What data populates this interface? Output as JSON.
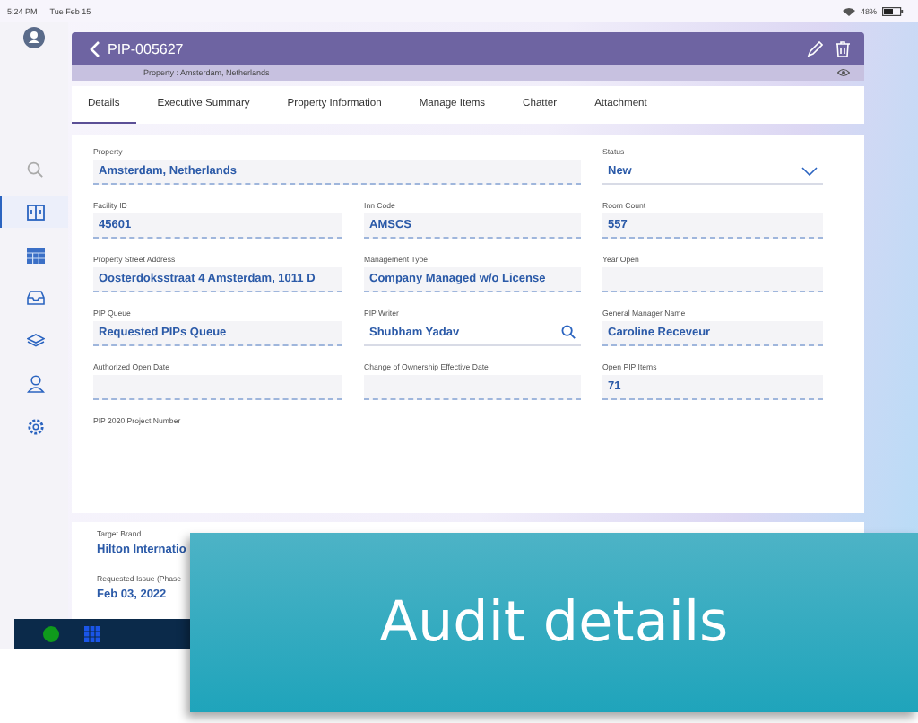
{
  "status_bar": {
    "time": "5:24 PM",
    "date": "Tue Feb 15",
    "battery": "48%"
  },
  "sidebar": {
    "items": [
      {
        "selected": false
      },
      {
        "selected": true
      },
      {
        "selected": false
      },
      {
        "selected": false
      },
      {
        "selected": false
      },
      {
        "selected": false
      },
      {
        "selected": false
      }
    ]
  },
  "header": {
    "title": "PIP-005627",
    "subtitle": "Property : Amsterdam, Netherlands"
  },
  "tabs": [
    {
      "label": "Details",
      "selected": true
    },
    {
      "label": "Executive Summary",
      "selected": false
    },
    {
      "label": "Property Information",
      "selected": false
    },
    {
      "label": "Manage Items",
      "selected": false
    },
    {
      "label": "Chatter",
      "selected": false
    },
    {
      "label": "Attachment",
      "selected": false
    }
  ],
  "fields": [
    {
      "label": "Property",
      "value": "Amsterdam, Netherlands",
      "kind": "wide"
    },
    {
      "label": "Status",
      "value": "New",
      "kind": "dropdown"
    },
    {
      "label": "Facility ID",
      "value": "45601",
      "kind": "text"
    },
    {
      "label": "Inn Code",
      "value": "AMSCS",
      "kind": "text"
    },
    {
      "label": "Room Count",
      "value": "557",
      "kind": "text"
    },
    {
      "label": "Property Street Address",
      "value": "Oosterdoksstraat 4 Amsterdam, 1011 D",
      "kind": "text"
    },
    {
      "label": "Management Type",
      "value": "Company Managed w/o License",
      "kind": "text"
    },
    {
      "label": "Year Open",
      "kind": "text"
    },
    {
      "label": "PIP Queue",
      "value": "Requested PIPs Queue",
      "kind": "text"
    },
    {
      "label": "PIP Writer",
      "value": "Shubham Yadav",
      "kind": "lookup"
    },
    {
      "label": "General Manager Name",
      "value": "Caroline  Receveur",
      "kind": "text"
    },
    {
      "label": "Authorized Open Date",
      "kind": "text"
    },
    {
      "label": "Change of Ownership Effective Date",
      "kind": "text"
    },
    {
      "label": "Open PIP Items",
      "value": "71",
      "kind": "text"
    },
    {
      "label": "PIP 2020 Project Number",
      "kind": "label"
    }
  ],
  "lower_fields": [
    {
      "label": "Target Brand",
      "value": "Hilton Internatio"
    },
    {
      "label": "Requested Issue (Phase",
      "value": "Feb 03, 2022"
    }
  ],
  "banner": {
    "text": "Audit details"
  }
}
